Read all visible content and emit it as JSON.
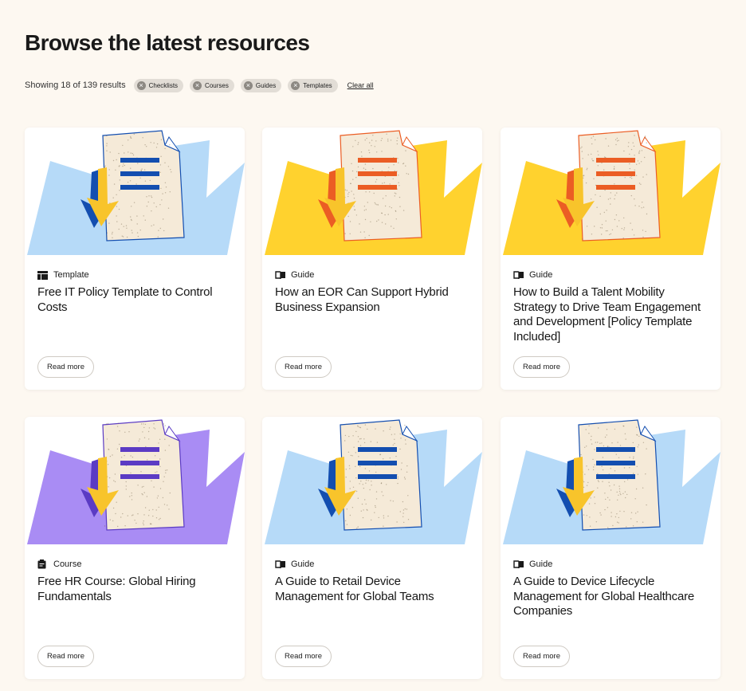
{
  "page": {
    "title": "Browse the latest resources"
  },
  "filters": {
    "results_text": "Showing 18 of 139 results",
    "chips": [
      "Checklists",
      "Courses",
      "Guides",
      "Templates"
    ],
    "clear_label": "Clear all"
  },
  "colors": {
    "blue_bg": "#b6daf8",
    "yellow_bg": "#ffd22e",
    "purple_bg": "#a98cf4",
    "blue_accent": "#134eb0",
    "orange_accent": "#eb5d24",
    "purple_accent": "#5b3bc4",
    "paper": "#f5ead8"
  },
  "cards": [
    {
      "type": "Template",
      "type_icon": "template-icon",
      "title": "Free IT Policy Template to Control Costs",
      "cta": "Read more",
      "theme": "blue",
      "accent": "blue"
    },
    {
      "type": "Guide",
      "type_icon": "book-icon",
      "title": "How an EOR Can Support Hybrid Business Expansion",
      "cta": "Read more",
      "theme": "yellow",
      "accent": "orange"
    },
    {
      "type": "Guide",
      "type_icon": "book-icon",
      "title": "How to Build a Talent Mobility Strategy to Drive Team Engagement and Development [Policy Template Included]",
      "cta": "Read more",
      "theme": "yellow",
      "accent": "orange"
    },
    {
      "type": "Course",
      "type_icon": "clipboard-icon",
      "title": "Free HR Course: Global Hiring Fundamentals",
      "cta": "Read more",
      "theme": "purple",
      "accent": "purple"
    },
    {
      "type": "Guide",
      "type_icon": "book-icon",
      "title": "A Guide to Retail Device Management for Global Teams",
      "cta": "Read more",
      "theme": "blue",
      "accent": "blue"
    },
    {
      "type": "Guide",
      "type_icon": "book-icon",
      "title": "A Guide to Device Lifecycle Management for Global Healthcare Companies",
      "cta": "Read more",
      "theme": "blue",
      "accent": "blue"
    }
  ]
}
